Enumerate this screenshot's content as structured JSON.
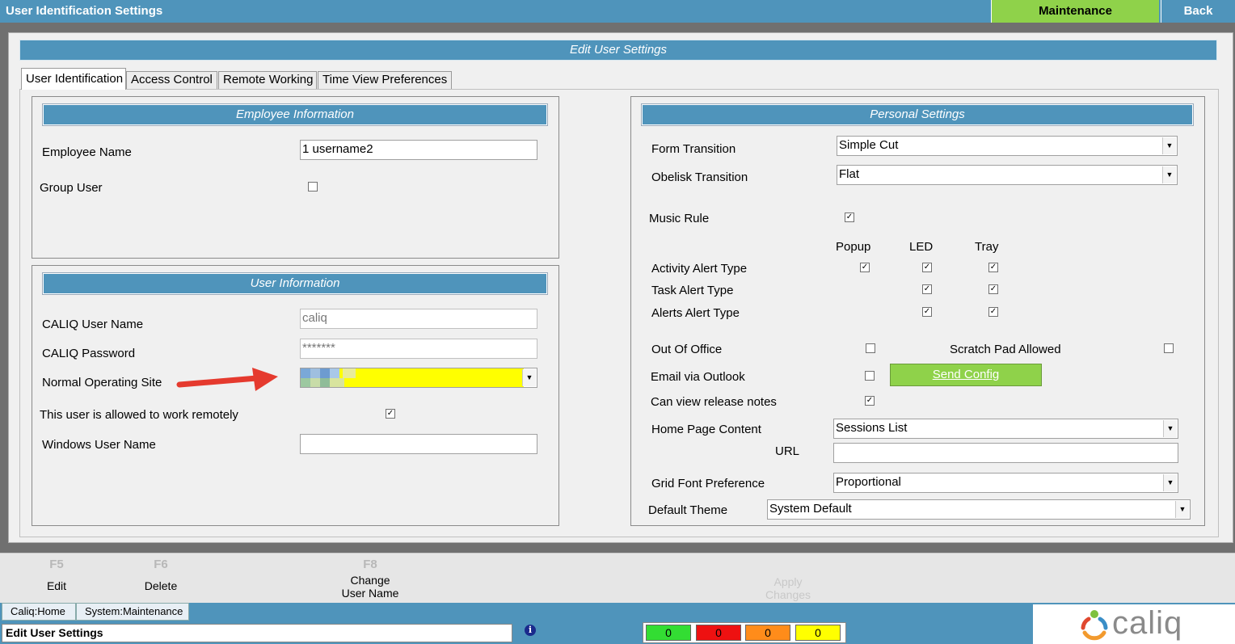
{
  "window": {
    "title": "User Identification Settings"
  },
  "header_buttons": {
    "maintenance": "Maintenance",
    "back": "Back"
  },
  "panel_title": "Edit User Settings",
  "tabs": [
    {
      "label": "User Identification",
      "active": true
    },
    {
      "label": "Access Control"
    },
    {
      "label": "Remote Working"
    },
    {
      "label": "Time View Preferences"
    }
  ],
  "employee_info": {
    "title": "Employee Information",
    "employee_name_label": "Employee Name",
    "employee_name_value": "1 username2",
    "group_user_label": "Group User",
    "group_user_checked": false
  },
  "user_info": {
    "title": "User Information",
    "caliq_user_name_label": "CALIQ User Name",
    "caliq_user_name_value": "caliq",
    "caliq_password_label": "CALIQ Password",
    "caliq_password_value": "*******",
    "normal_operating_site_label": "Normal Operating Site",
    "remote_label": "This user is allowed to work remotely",
    "remote_checked": true,
    "windows_user_name_label": "Windows User Name",
    "windows_user_name_value": ""
  },
  "personal": {
    "title": "Personal Settings",
    "form_transition_label": "Form Transition",
    "form_transition_value": "Simple Cut",
    "obelisk_transition_label": "Obelisk Transition",
    "obelisk_transition_value": "Flat",
    "music_rule_label": "Music Rule",
    "col_popup": "Popup",
    "col_led": "LED",
    "col_tray": "Tray",
    "activity_alert_label": "Activity Alert Type",
    "task_alert_label": "Task Alert Type",
    "alerts_alert_label": "Alerts Alert Type",
    "out_of_office_label": "Out Of Office",
    "scratch_pad_label": "Scratch Pad Allowed",
    "email_outlook_label": "Email via Outlook",
    "send_config_label": "Send Config",
    "release_notes_label": "Can view release notes",
    "home_page_label": "Home Page Content",
    "home_page_value": "Sessions List",
    "url_label": "URL",
    "url_value": "",
    "grid_font_label": "Grid Font Preference",
    "grid_font_value": "Proportional",
    "default_theme_label": "Default Theme",
    "default_theme_value": "System Default"
  },
  "fkeys": [
    {
      "key": "F5",
      "label": "Edit"
    },
    {
      "key": "F6",
      "label": "Delete"
    },
    {
      "key": "F8",
      "label": "Change\nUser Name"
    },
    {
      "key": "",
      "label": "Apply\nChanges",
      "disabled": true
    }
  ],
  "bottom_tabs": [
    "Caliq:Home",
    "System:Maintenance"
  ],
  "status_text": "Edit User Settings",
  "counters": [
    {
      "value": "0",
      "color": "#33dd33"
    },
    {
      "value": "0",
      "color": "#ee1111"
    },
    {
      "value": "0",
      "color": "#ff8c1a"
    },
    {
      "value": "0",
      "color": "#ffff00"
    }
  ],
  "colors": {
    "accent": "#4f94bb",
    "maintenance": "#8fd24a",
    "highlight": "#ffff00",
    "arrow": "#e53a2e"
  },
  "logo_text": "caliq"
}
